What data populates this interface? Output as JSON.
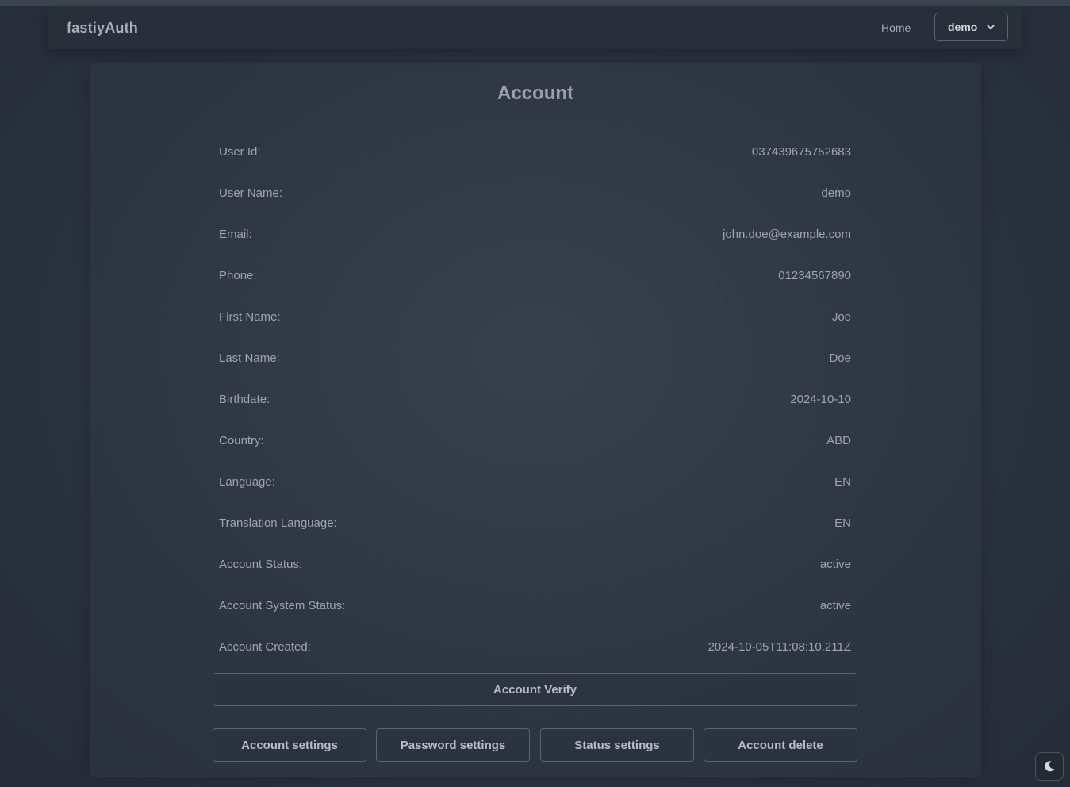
{
  "navbar": {
    "brand": "fastiyAuth",
    "home_label": "Home",
    "user_menu_label": "demo"
  },
  "account": {
    "title": "Account",
    "fields": [
      {
        "label": "User Id:",
        "value": "037439675752683"
      },
      {
        "label": "User Name:",
        "value": "demo"
      },
      {
        "label": "Email:",
        "value": "john.doe@example.com"
      },
      {
        "label": "Phone:",
        "value": "01234567890"
      },
      {
        "label": "First Name:",
        "value": "Joe"
      },
      {
        "label": "Last Name:",
        "value": "Doe"
      },
      {
        "label": "Birthdate:",
        "value": "2024-10-10"
      },
      {
        "label": "Country:",
        "value": "ABD"
      },
      {
        "label": "Language:",
        "value": "EN"
      },
      {
        "label": "Translation Language:",
        "value": "EN"
      },
      {
        "label": "Account Status:",
        "value": "active"
      },
      {
        "label": "Account System Status:",
        "value": "active"
      },
      {
        "label": "Account Created:",
        "value": "2024-10-05T11:08:10.211Z"
      }
    ]
  },
  "buttons": {
    "verify": "Account Verify",
    "account_settings": "Account settings",
    "password_settings": "Password settings",
    "status_settings": "Status settings",
    "account_delete": "Account delete"
  },
  "icons": {
    "user_menu": "chevron-down-icon",
    "theme_toggle": "moon-icon"
  },
  "colors": {
    "background": "#2b3340",
    "border": "#5a6370",
    "text": "#9ea5b0"
  }
}
